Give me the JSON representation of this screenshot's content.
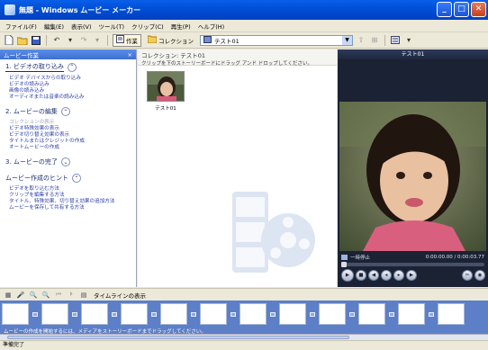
{
  "window": {
    "title": "無題 - Windows ムービー メーカー"
  },
  "menu": [
    "ファイル(F)",
    "編集(E)",
    "表示(V)",
    "ツール(T)",
    "クリップ(C)",
    "再生(P)",
    "ヘルプ(H)"
  ],
  "toolbar": {
    "tasks_label": "作業",
    "collections_label": "コレクション",
    "collection_value": "テスト01"
  },
  "taskpane": {
    "header": "ムービー作業",
    "close": "×",
    "sections": [
      {
        "title": "1. ビデオの取り込み",
        "links": [
          "ビデオ デバイスからの取り込み",
          "ビデオの読み込み",
          "画像の読み込み",
          "オーディオまたは音楽の読み込み"
        ]
      },
      {
        "title": "2. ムービーの編集",
        "links": [
          "コレクションの表示",
          "ビデオ特殊効果の表示",
          "ビデオ切り替え効果の表示",
          "タイトルまたはクレジットの作成",
          "オートムービーの作成"
        ]
      },
      {
        "title": "3. ムービーの完了",
        "links": []
      },
      {
        "title": "ムービー作成のヒント",
        "links": [
          "ビデオを取り込む方法",
          "クリップを編集する方法",
          "タイトル、特殊効果、切り替え効果の追加方法",
          "ムービーを保存して共有する方法"
        ]
      }
    ]
  },
  "collection": {
    "title": "コレクション: テスト01",
    "hint": "クリップを下のストーリーボードにドラッグ アンド ドロップしてください。",
    "clip_label": "テスト01"
  },
  "monitor": {
    "title": "テスト01",
    "status": "一時停止",
    "time": "0:00:00.00 / 0:00:03.77",
    "progress": 0
  },
  "storyboard": {
    "toolbar_label": "タイムラインの表示",
    "hint": "ムービーの作成を開始するには、メディアをストーリーボードまでドラッグしてください。"
  },
  "statusbar": {
    "text": "準備完了"
  },
  "colors": {
    "title_bar": "#0050D8",
    "storyboard_bg": "#5d7fc7",
    "monitor_bg": "#1b2233",
    "link": "#2b3da8"
  }
}
